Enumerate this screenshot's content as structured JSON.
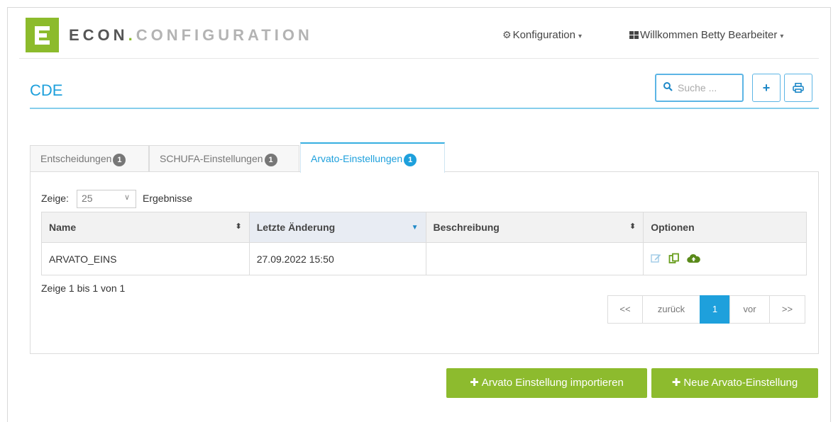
{
  "header": {
    "brand_part1": "ECON",
    "brand_dot": ".",
    "brand_part2": "CONFIGURATION",
    "config_menu": "Konfiguration",
    "user_menu": "Willkommen Betty Bearbeiter"
  },
  "page": {
    "title": "CDE",
    "search_placeholder": "Suche ..."
  },
  "tabs": [
    {
      "label": "Entscheidungen",
      "badge": "1",
      "active": false
    },
    {
      "label": "SCHUFA-Einstellungen",
      "badge": "1",
      "active": false
    },
    {
      "label": "Arvato-Einstellungen",
      "badge": "1",
      "active": true
    }
  ],
  "listing": {
    "show_label": "Zeige:",
    "page_size": "25",
    "show_after": "Ergebnisse",
    "columns": [
      "Name",
      "Letzte Änderung",
      "Beschreibung",
      "Optionen"
    ],
    "rows": [
      {
        "name": "ARVATO_EINS",
        "changed": "27.09.2022 15:50",
        "description": ""
      }
    ],
    "info": "Zeige 1 bis 1 von 1"
  },
  "pagination": {
    "first": "<<",
    "prev": "zurück",
    "current": "1",
    "next": "vor",
    "last": ">>"
  },
  "actions": {
    "import_label": "Arvato Einstellung importieren",
    "new_label": "Neue Arvato-Einstellung"
  },
  "colors": {
    "brand_green": "#8cbb2c",
    "accent_blue": "#1ea0dc"
  },
  "icons": [
    "gear-icon",
    "grid-icon",
    "search-icon",
    "plus-icon",
    "print-icon",
    "sort-icon",
    "edit-icon",
    "copy-icon",
    "cloud-upload-icon"
  ]
}
